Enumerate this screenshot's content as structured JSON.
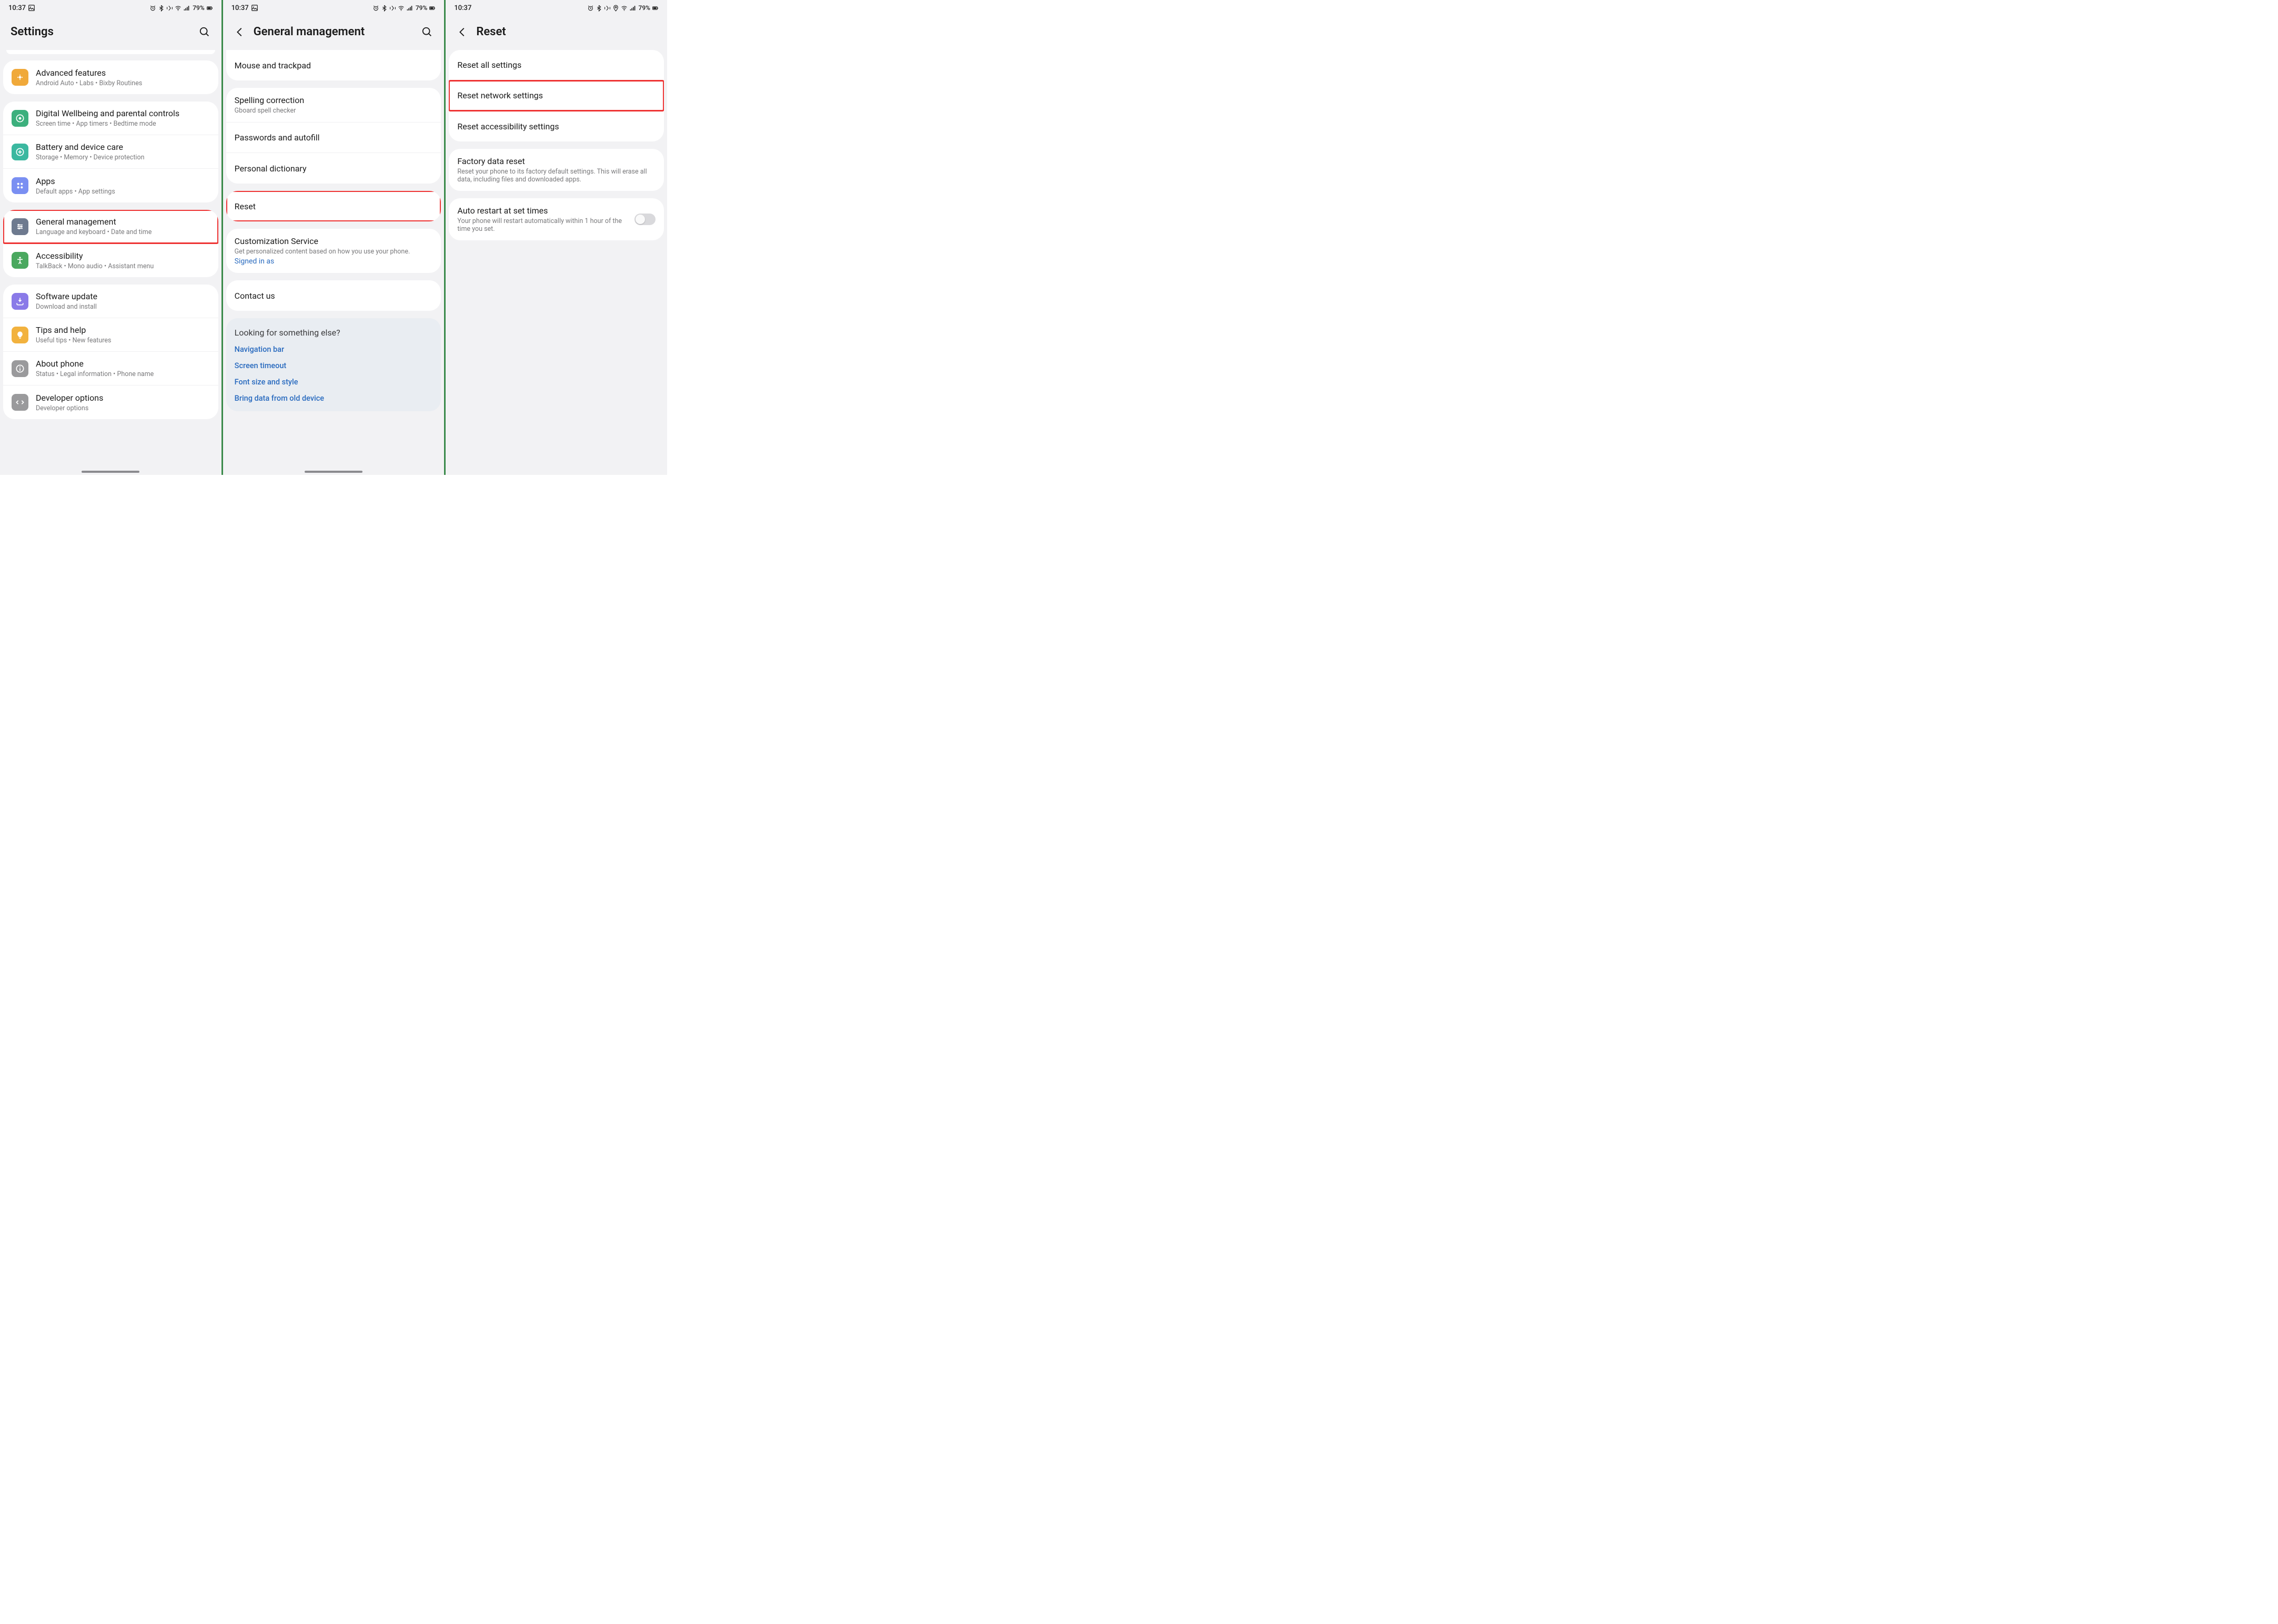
{
  "status": {
    "time": "10:37",
    "battery": "79%"
  },
  "screen1": {
    "title": "Settings",
    "groups": [
      {
        "pilltop": true
      },
      {
        "rows": [
          {
            "icon": "adv",
            "color": "#f0a93a",
            "title": "Advanced features",
            "sub": "Android Auto  •  Labs  •  Bixby Routines"
          }
        ]
      },
      {
        "rows": [
          {
            "icon": "wellbeing",
            "color": "#3cb07d",
            "title": "Digital Wellbeing and parental controls",
            "sub": "Screen time  •  App timers  •  Bedtime mode"
          },
          {
            "icon": "battery",
            "color": "#3bb8a0",
            "title": "Battery and device care",
            "sub": "Storage  •  Memory  •  Device protection"
          },
          {
            "icon": "apps",
            "color": "#7a8ff2",
            "title": "Apps",
            "sub": "Default apps  •  App settings"
          }
        ]
      },
      {
        "rows": [
          {
            "icon": "sliders",
            "color": "#6e7a8f",
            "title": "General management",
            "sub": "Language and keyboard  •  Date and time",
            "highlight": true
          },
          {
            "icon": "accessibility",
            "color": "#4aa85f",
            "title": "Accessibility",
            "sub": "TalkBack  •  Mono audio  •  Assistant menu"
          }
        ]
      },
      {
        "rows": [
          {
            "icon": "update",
            "color": "#8a7ae8",
            "title": "Software update",
            "sub": "Download and install"
          },
          {
            "icon": "bulb",
            "color": "#f2b23e",
            "title": "Tips and help",
            "sub": "Useful tips  •  New features"
          },
          {
            "icon": "info",
            "color": "#9a9a9c",
            "title": "About phone",
            "sub": "Status  •  Legal information  •  Phone name"
          },
          {
            "icon": "dev",
            "color": "#9a9a9c",
            "title": "Developer options",
            "sub": "Developer options"
          }
        ]
      }
    ]
  },
  "screen2": {
    "title": "General management",
    "groups": [
      {
        "rows": [
          {
            "title": "Mouse and trackpad"
          }
        ]
      },
      {
        "rows": [
          {
            "title": "Spelling correction",
            "sub": "Gboard spell checker"
          },
          {
            "title": "Passwords and autofill"
          },
          {
            "title": "Personal dictionary"
          }
        ]
      },
      {
        "rows": [
          {
            "title": "Reset",
            "highlight": true
          }
        ]
      },
      {
        "rows": [
          {
            "title": "Customization Service",
            "sub": "Get personalized content based on how you use your phone.",
            "link": "Signed in as"
          }
        ]
      },
      {
        "rows": [
          {
            "title": "Contact us"
          }
        ]
      }
    ],
    "suggest": {
      "header": "Looking for something else?",
      "links": [
        "Navigation bar",
        "Screen timeout",
        "Font size and style",
        "Bring data from old device"
      ]
    }
  },
  "screen3": {
    "title": "Reset",
    "groups": [
      {
        "rows": [
          {
            "title": "Reset all settings"
          },
          {
            "title": "Reset network settings",
            "highlight": true
          },
          {
            "title": "Reset accessibility settings"
          }
        ]
      },
      {
        "rows": [
          {
            "title": "Factory data reset",
            "sub": "Reset your phone to its factory default settings. This will erase all data, including files and downloaded apps."
          }
        ]
      },
      {
        "rows": [
          {
            "title": "Auto restart at set times",
            "sub": "Your phone will restart automatically within 1 hour of the time you set.",
            "toggle": false
          }
        ]
      }
    ]
  }
}
